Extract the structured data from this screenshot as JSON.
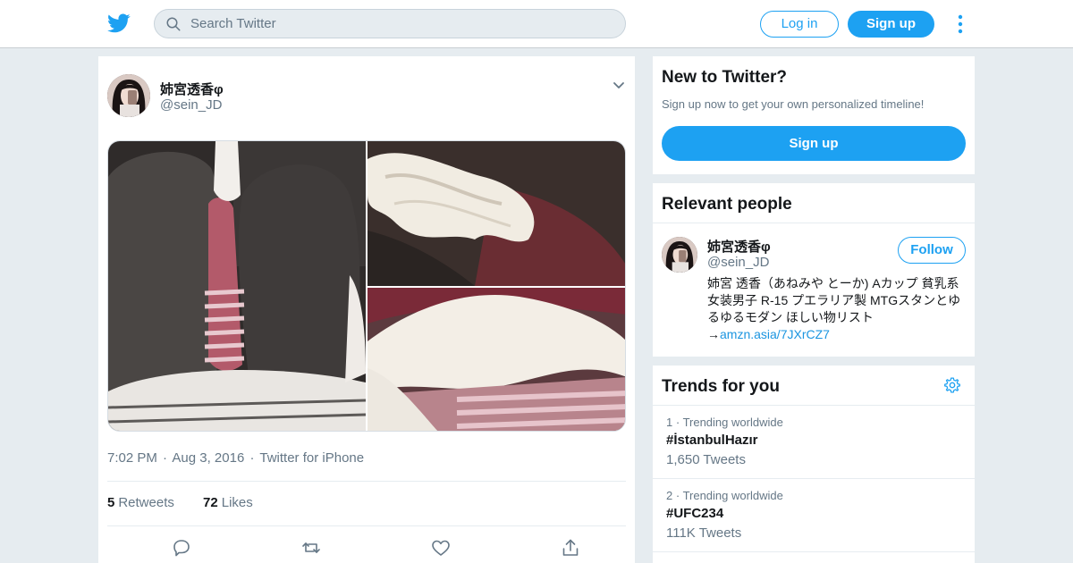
{
  "header": {
    "logo_icon": "twitter-bird-icon",
    "search_placeholder": "Search Twitter",
    "login_label": "Log in",
    "signup_label": "Sign up",
    "more_icon": "vertical-dots-icon",
    "brand_color": "#1da1f2"
  },
  "tweet": {
    "display_name": "姉宮透香φ",
    "handle": "@sein_JD",
    "time": "7:02 PM",
    "date": "Aug 3, 2016",
    "source": "Twitter for iPhone",
    "sep": "·",
    "retweets_count": "5",
    "retweets_label": "Retweets",
    "likes_count": "72",
    "likes_label": "Likes",
    "media_count": 3
  },
  "sidebar": {
    "new_to_twitter": {
      "title": "New to Twitter?",
      "subtitle": "Sign up now to get your own personalized timeline!",
      "button_label": "Sign up"
    },
    "relevant_people": {
      "title": "Relevant people",
      "person": {
        "display_name": "姉宮透香φ",
        "handle": "@sein_JD",
        "follow_label": "Follow",
        "bio_text": "姉宮 透香（あねみや とーか) Aカップ 貧乳系女装男子 R-15 プエラリア製 MTGスタンとゆるゆるモダン ほしい物リスト→",
        "bio_link": "amzn.asia/7JXrCZ7"
      }
    },
    "trends": {
      "title": "Trends for you",
      "items": [
        {
          "rank": "1",
          "context": "Trending worldwide",
          "name": "#İstanbulHazır",
          "count": "1,650 Tweets"
        },
        {
          "rank": "2",
          "context": "Trending worldwide",
          "name": "#UFC234",
          "count": "111K Tweets"
        }
      ]
    }
  }
}
